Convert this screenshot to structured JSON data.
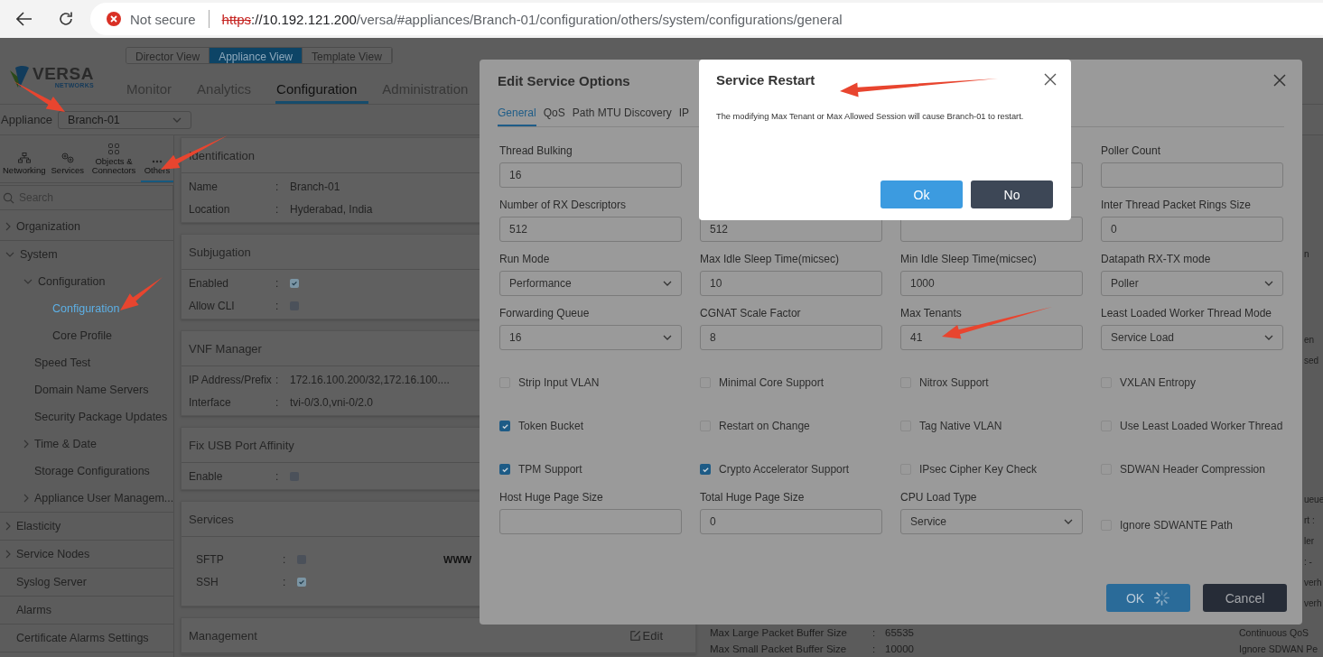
{
  "browser": {
    "security_label": "Not secure",
    "url_scheme": "https",
    "url_host": "://10.192.121.200",
    "url_path": "/versa/#appliances/Branch-01/configuration/others/system/configurations/general"
  },
  "logo": {
    "name": "VERSA",
    "tagline": "NETWORKS"
  },
  "view_switch": [
    {
      "label": "Director View",
      "selected": false
    },
    {
      "label": "Appliance View",
      "selected": true
    },
    {
      "label": "Template View",
      "selected": false
    }
  ],
  "main_tabs": [
    {
      "label": "Monitor",
      "selected": false
    },
    {
      "label": "Analytics",
      "selected": false
    },
    {
      "label": "Configuration",
      "selected": true
    },
    {
      "label": "Administration",
      "selected": false
    }
  ],
  "appliance": {
    "label": "Appliance",
    "value": "Branch-01"
  },
  "sidebar": {
    "tabs": [
      {
        "label": "Networking",
        "kind": "network",
        "selected": false
      },
      {
        "label": "Services",
        "kind": "services",
        "selected": false
      },
      {
        "label": "Objects & Connectors",
        "kind": "objects",
        "selected": false
      },
      {
        "label": "Others",
        "kind": "others",
        "selected": true
      }
    ],
    "search": {
      "placeholder": "Search"
    },
    "tree": [
      {
        "label": "Organization",
        "expanded": false,
        "selected": false
      },
      {
        "label": "System",
        "expanded": true,
        "selected": false,
        "children": [
          {
            "label": "Configuration",
            "expanded": true,
            "selected": false,
            "children": [
              {
                "label": "Configuration",
                "selected": true
              },
              {
                "label": "Core Profile",
                "selected": false
              }
            ]
          },
          {
            "label": "Speed Test",
            "selected": false
          },
          {
            "label": "Domain Name Servers",
            "selected": false
          },
          {
            "label": "Security Package Updates",
            "selected": false
          },
          {
            "label": "Time & Date",
            "expanded": false,
            "selected": false
          },
          {
            "label": "Storage Configurations",
            "selected": false
          },
          {
            "label": "Appliance User Managem...",
            "expanded": false,
            "selected": false
          }
        ]
      },
      {
        "label": "Elasticity",
        "expanded": false,
        "selected": false
      },
      {
        "label": "Service Nodes",
        "expanded": false,
        "selected": false
      },
      {
        "label": "Syslog Server",
        "selected": false
      },
      {
        "label": "Alarms",
        "selected": false
      },
      {
        "label": "Certificate Alarms Settings",
        "selected": false
      }
    ]
  },
  "cards": [
    {
      "title": "Identification",
      "rows": [
        {
          "label": "Name",
          "sep": ":",
          "kind": "text",
          "value": "Branch-01"
        },
        {
          "label": "Location",
          "sep": ":",
          "kind": "text",
          "value": "Hyderabad, India"
        }
      ]
    },
    {
      "title": "Subjugation",
      "rows": [
        {
          "label": "Enabled",
          "sep": ":",
          "kind": "checkbox",
          "checked": true
        },
        {
          "label": "Allow CLI",
          "sep": ":",
          "kind": "checkbox",
          "checked": false
        }
      ]
    },
    {
      "title": "VNF Manager",
      "rows": [
        {
          "label": "IP Address/Prefix",
          "sep": ":",
          "kind": "text",
          "value": "172.16.100.200/32,172.16.100...."
        },
        {
          "label": "Interface",
          "sep": ":",
          "kind": "text",
          "value": "tvi-0/3.0,vni-0/2.0"
        }
      ]
    },
    {
      "title": "Fix USB Port Affinity",
      "rows": [
        {
          "label": "Enable",
          "sep": ":",
          "kind": "checkbox",
          "checked": false
        }
      ]
    },
    {
      "title": "Services",
      "rows": [
        {
          "label": "SFTP",
          "sep": ":",
          "kind": "checkbox",
          "checked": false,
          "aside": "WWW"
        },
        {
          "label": "SSH",
          "sep": ":",
          "kind": "checkbox",
          "checked": true
        }
      ]
    },
    {
      "title": "Management",
      "action": "Edit"
    }
  ],
  "right_panel": {
    "edge_groups": [
      {
        "texts": [
          "n"
        ]
      },
      {
        "texts": [
          "en",
          "sed"
        ]
      },
      {
        "texts": [
          "ueue",
          "rt :",
          "ler",
          ": -",
          "verh",
          "verh"
        ]
      }
    ],
    "stats": [
      {
        "label": "Max Large Packet Buffer Size",
        "sep": ":",
        "value": "65535",
        "side_text": "Continuous QoS"
      },
      {
        "label": "Max Small Packet Buffer Size",
        "sep": ":",
        "value": "10000",
        "side_text": "Ignore SDWAN Pe"
      }
    ]
  },
  "edit_dialog": {
    "title": "Edit Service Options",
    "tabs": [
      {
        "label": "General",
        "selected": true
      },
      {
        "label": "QoS",
        "selected": false
      },
      {
        "label": "Path MTU Discovery",
        "selected": false
      },
      {
        "label": "IP",
        "selected": false
      }
    ],
    "fields": [
      {
        "kind": "input",
        "label": "Thread Bulking",
        "value": "16"
      },
      {
        "kind": "blank"
      },
      {
        "kind": "input"
      },
      {
        "kind": "input",
        "label": "Poller Count"
      },
      {
        "kind": "input",
        "label": "Number of RX Descriptors",
        "value": "512"
      },
      {
        "kind": "input",
        "value": "512"
      },
      {
        "kind": "input"
      },
      {
        "kind": "input",
        "label": "Inter Thread Packet Rings Size",
        "value": "0"
      },
      {
        "kind": "select",
        "label": "Run Mode",
        "value": "Performance"
      },
      {
        "kind": "input",
        "label": "Max Idle Sleep Time(micsec)",
        "value": "10"
      },
      {
        "kind": "input",
        "label": "Min Idle Sleep Time(micsec)",
        "value": "1000"
      },
      {
        "kind": "select",
        "label": "Datapath RX-TX mode",
        "value": "Poller"
      },
      {
        "kind": "select",
        "label": "Forwarding Queue",
        "value": "16"
      },
      {
        "kind": "input",
        "label": "CGNAT Scale Factor",
        "value": "8"
      },
      {
        "kind": "input",
        "label": "Max Tenants",
        "value": "41"
      },
      {
        "kind": "select",
        "label": "Least Loaded Worker Thread Mode",
        "value": "Service Load"
      },
      {
        "kind": "checkbox",
        "label": "Strip Input VLAN",
        "checked": false
      },
      {
        "kind": "checkbox",
        "label": "Minimal Core Support",
        "checked": false
      },
      {
        "kind": "checkbox",
        "label": "Nitrox Support",
        "checked": false
      },
      {
        "kind": "checkbox",
        "label": "VXLAN Entropy",
        "checked": false
      },
      {
        "kind": "checkbox",
        "label": "Token Bucket",
        "checked": true
      },
      {
        "kind": "checkbox",
        "label": "Restart on Change",
        "checked": false
      },
      {
        "kind": "checkbox",
        "label": "Tag Native VLAN",
        "checked": false
      },
      {
        "kind": "checkbox",
        "label": "Use Least Loaded Worker Thread",
        "checked": false
      },
      {
        "kind": "checkbox",
        "label": "TPM Support",
        "checked": true
      },
      {
        "kind": "checkbox",
        "label": "Crypto Accelerator Support",
        "checked": true
      },
      {
        "kind": "checkbox",
        "label": "IPsec Cipher Key Check",
        "checked": false
      },
      {
        "kind": "checkbox",
        "label": "SDWAN Header Compression",
        "checked": false
      },
      {
        "kind": "input",
        "label": "Host Huge Page Size"
      },
      {
        "kind": "input",
        "label": "Total Huge Page Size",
        "value": "0"
      },
      {
        "kind": "select",
        "label": "CPU Load Type",
        "value": "Service"
      },
      {
        "kind": "checkbox",
        "label": "Ignore SDWANTE Path",
        "checked": false
      }
    ],
    "buttons": [
      {
        "label": "OK",
        "kind": "primary",
        "busy": true
      },
      {
        "label": "Cancel",
        "kind": "secondary",
        "busy": false
      }
    ]
  },
  "restart_dialog": {
    "title": "Service Restart",
    "message": "The modifying Max Tenant or Max Allowed Session will cause Branch-01 to restart.",
    "buttons": [
      {
        "label": "Ok",
        "kind": "primary"
      },
      {
        "label": "No",
        "kind": "secondary"
      }
    ]
  }
}
